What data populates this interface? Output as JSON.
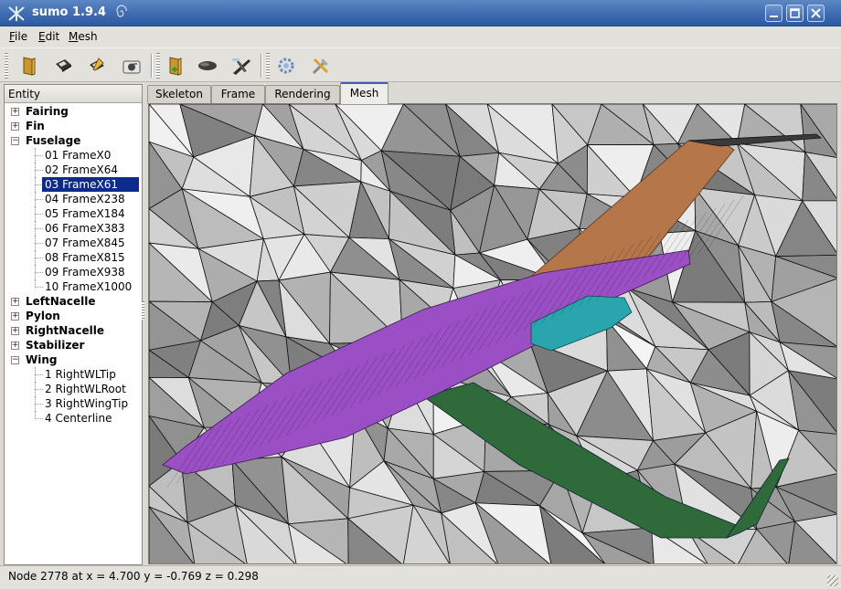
{
  "window": {
    "title": "sumo 1.9.4"
  },
  "menu": [
    {
      "accel": "F",
      "rest": "ile"
    },
    {
      "accel": "E",
      "rest": "dit"
    },
    {
      "accel": "M",
      "rest": "esh"
    }
  ],
  "toolbar": {
    "icons": [
      "open-folder-icon",
      "save-disk-icon",
      "save-as-icon",
      "screenshot-camera-icon",
      "new-component-icon",
      "fuselage-icon",
      "wing-icon",
      "mesh-settings-icon",
      "tools-icon"
    ]
  },
  "tree": {
    "header": "Entity",
    "rows": [
      {
        "label": "Fairing",
        "kind": "group",
        "expanded": false
      },
      {
        "label": "Fin",
        "kind": "group",
        "expanded": false
      },
      {
        "label": "Fuselage",
        "kind": "group",
        "expanded": true
      },
      {
        "label": "01 FrameX0",
        "kind": "child"
      },
      {
        "label": "02 FrameX64",
        "kind": "child"
      },
      {
        "label": "03 FrameX61",
        "kind": "child",
        "selected": true
      },
      {
        "label": "04 FrameX238",
        "kind": "child"
      },
      {
        "label": "05 FrameX184",
        "kind": "child"
      },
      {
        "label": "06 FrameX383",
        "kind": "child"
      },
      {
        "label": "07 FrameX845",
        "kind": "child"
      },
      {
        "label": "08 FrameX815",
        "kind": "child"
      },
      {
        "label": "09 FrameX938",
        "kind": "child"
      },
      {
        "label": "10 FrameX1000",
        "kind": "child",
        "last": true
      },
      {
        "label": "LeftNacelle",
        "kind": "group",
        "expanded": false
      },
      {
        "label": "Pylon",
        "kind": "group",
        "expanded": false
      },
      {
        "label": "RightNacelle",
        "kind": "group",
        "expanded": false
      },
      {
        "label": "Stabilizer",
        "kind": "group",
        "expanded": false
      },
      {
        "label": "Wing",
        "kind": "group",
        "expanded": true
      },
      {
        "label": "1 RightWLTip",
        "kind": "child"
      },
      {
        "label": "2 RightWLRoot",
        "kind": "child"
      },
      {
        "label": "3 RightWingTip",
        "kind": "child"
      },
      {
        "label": "4 Centerline",
        "kind": "child",
        "last": true
      }
    ]
  },
  "tabs": [
    {
      "label": "Skeleton",
      "active": false
    },
    {
      "label": "Frame",
      "active": false
    },
    {
      "label": "Rendering",
      "active": false
    },
    {
      "label": "Mesh",
      "active": true
    }
  ],
  "viewport": {
    "colors": {
      "fuselage": "#9b4fc4",
      "fin": "#b5764a",
      "nacelle": "#2aa5ad",
      "wing": "#2f6a3a",
      "background": "#c8c8c8"
    }
  },
  "status": {
    "text": "Node 2778 at x = 4.700 y = -0.769 z = 0.298"
  }
}
